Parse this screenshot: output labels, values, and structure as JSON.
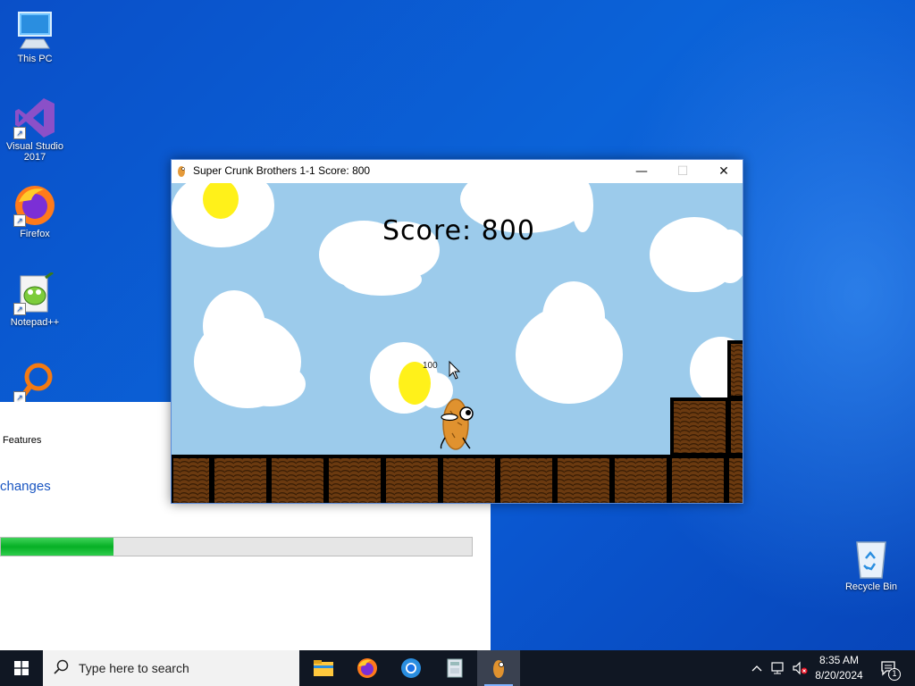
{
  "desktop": {
    "icons": [
      {
        "label": "This PC"
      },
      {
        "label": "Visual Studio 2017"
      },
      {
        "label": "Firefox"
      },
      {
        "label": "Notepad++"
      },
      {
        "label": ""
      },
      {
        "label": "Recycle Bin"
      }
    ]
  },
  "installer": {
    "features_text": "Features",
    "changes_link": "changes",
    "progress": 0.24
  },
  "game_window": {
    "title": "Super Crunk Brothers 1-1 Score: 800",
    "controls": {
      "minimize": "—",
      "maximize": "☐",
      "close": "✕"
    },
    "score_label": "Score: 800",
    "points_popup": "100"
  },
  "taskbar": {
    "search_placeholder": "Type here to search",
    "apps": [
      "file-explorer",
      "firefox",
      "chrome",
      "installer",
      "super-crunk-brothers"
    ],
    "active_app": "super-crunk-brothers",
    "clock_time": "8:35 AM",
    "clock_date": "8/20/2024",
    "notification_count": "1"
  },
  "colors": {
    "sky": "#9ccbeb",
    "cloud": "#ffffff",
    "sun": "#fff11a",
    "brick": "#6b3a10",
    "progress_green": "#06b025",
    "taskbar": "#101723"
  }
}
